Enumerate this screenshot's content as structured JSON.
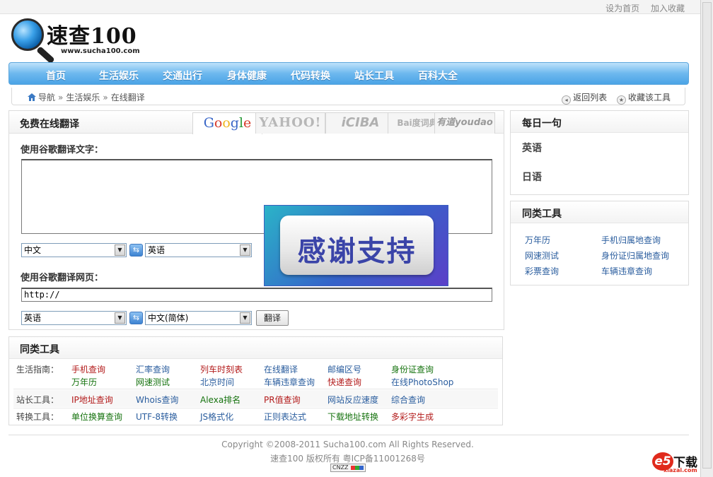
{
  "top_links": [
    "设为首页",
    "加入收藏"
  ],
  "logo": {
    "text": "速查100",
    "url": "www.sucha100.com"
  },
  "nav": [
    "首页",
    "生活娱乐",
    "交通出行",
    "身体健康",
    "代码转换",
    "站长工具",
    "百科大全"
  ],
  "breadcrumb": {
    "items": [
      "导航",
      "生活娱乐",
      "在线翻译"
    ],
    "separator": "»",
    "back": "返回列表",
    "favorite": "收藏该工具"
  },
  "translate": {
    "title": "免费在线翻译",
    "engines": [
      "Google",
      "YAHOO!",
      "iCIBA",
      "Bai度词典",
      "有道youdao"
    ],
    "text_label": "使用谷歌翻译文字：",
    "text_from": "中文",
    "text_to": "英语",
    "page_label": "使用谷歌翻译网页：",
    "url_value": "http://",
    "page_from": "英语",
    "page_to": "中文(简体)",
    "translate_button": "翻译",
    "swap_icon": "⇆"
  },
  "banner": {
    "text": "感谢支持"
  },
  "daily": {
    "title": "每日一句",
    "languages": [
      "英语",
      "日语"
    ]
  },
  "similar_right": {
    "title": "同类工具",
    "links": [
      "万年历",
      "手机归属地查询",
      "网速测试",
      "身份证归属地查询",
      "彩票查询",
      "车辆违章查询"
    ]
  },
  "tools": {
    "title": "同类工具",
    "rows": [
      {
        "label": "生活指南：",
        "links": [
          "手机查询",
          "汇率查询",
          "列车时刻表",
          "在线翻译",
          "邮编区号",
          "身份证查询",
          "万年历",
          "网速测试",
          "北京时间",
          "车辆违章查询",
          "快递查询",
          "在线PhotoShop"
        ]
      },
      {
        "label": "站长工具：",
        "links": [
          "IP地址查询",
          "Whois查询",
          "Alexa排名",
          "PR值查询",
          "网站反应速度",
          "综合查询"
        ]
      },
      {
        "label": "转换工具：",
        "links": [
          "单位换算查询",
          "UTF-8转换",
          "JS格式化",
          "正则表达式",
          "下载地址转换",
          "多彩字生成"
        ]
      }
    ]
  },
  "footer": {
    "copyright": "Copyright ©2008-2011 Sucha100.com All Rights Reserved.",
    "icp": "速查100 版权所有 粤ICP备11001268号",
    "stat_badge": "CNZZ"
  },
  "watermark": {
    "logo": "e5",
    "text": "下载",
    "domain": "xiazai.com"
  },
  "colors": {
    "nav": "#4ba4e6",
    "link_red": "#b31b1b",
    "link_blue": "#2a5d9e",
    "link_green": "#16730f"
  }
}
